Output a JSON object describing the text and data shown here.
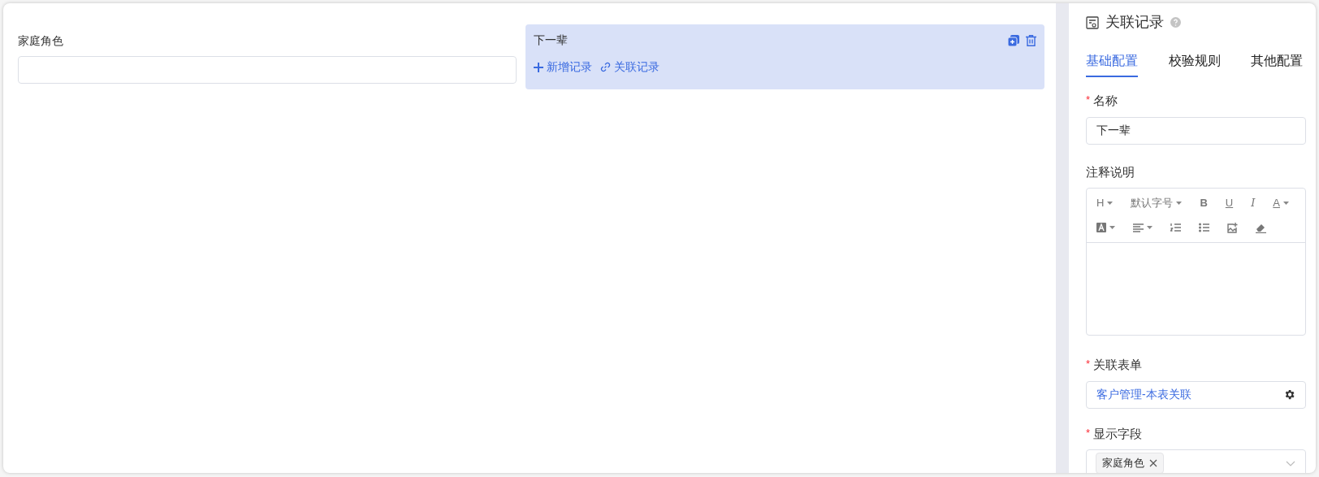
{
  "canvas": {
    "field": {
      "label": "家庭角色"
    },
    "subform": {
      "title": "下一辈",
      "selected": true,
      "actions": [
        {
          "kind": "add",
          "label": "新增记录"
        },
        {
          "kind": "link",
          "label": "关联记录"
        }
      ]
    }
  },
  "panel": {
    "title": "关联记录",
    "tabs": [
      {
        "label": "基础配置",
        "selected": true
      },
      {
        "label": "校验规则",
        "selected": false
      },
      {
        "label": "其他配置",
        "selected": false
      }
    ],
    "name": {
      "label": "名称",
      "mark": "*",
      "value": "下一辈"
    },
    "note": {
      "label": "注释说明",
      "toolbar": [
        [
          {
            "kind": "text",
            "label": "H",
            "dropdown": true
          },
          {
            "kind": "text",
            "label": "默认字号",
            "dropdown": true
          },
          {
            "kind": "bold",
            "label": "B",
            "dropdown": false
          },
          {
            "kind": "underline",
            "label": "U",
            "dropdown": false
          },
          {
            "kind": "italic",
            "label": "I",
            "dropdown": false
          },
          {
            "kind": "color",
            "label": "A",
            "dropdown": true
          }
        ],
        [
          {
            "kind": "highlight",
            "dropdown": true
          },
          {
            "kind": "align",
            "dropdown": true
          },
          {
            "kind": "ordered",
            "dropdown": false
          },
          {
            "kind": "bullets",
            "dropdown": false
          },
          {
            "kind": "image",
            "dropdown": false
          },
          {
            "kind": "eraser",
            "dropdown": false
          }
        ]
      ]
    },
    "form": {
      "label": "关联表单",
      "mark": "*",
      "value": "客户管理-本表关联"
    },
    "fields": {
      "label": "显示字段",
      "mark": "*",
      "tags": [
        "家庭角色"
      ]
    }
  }
}
